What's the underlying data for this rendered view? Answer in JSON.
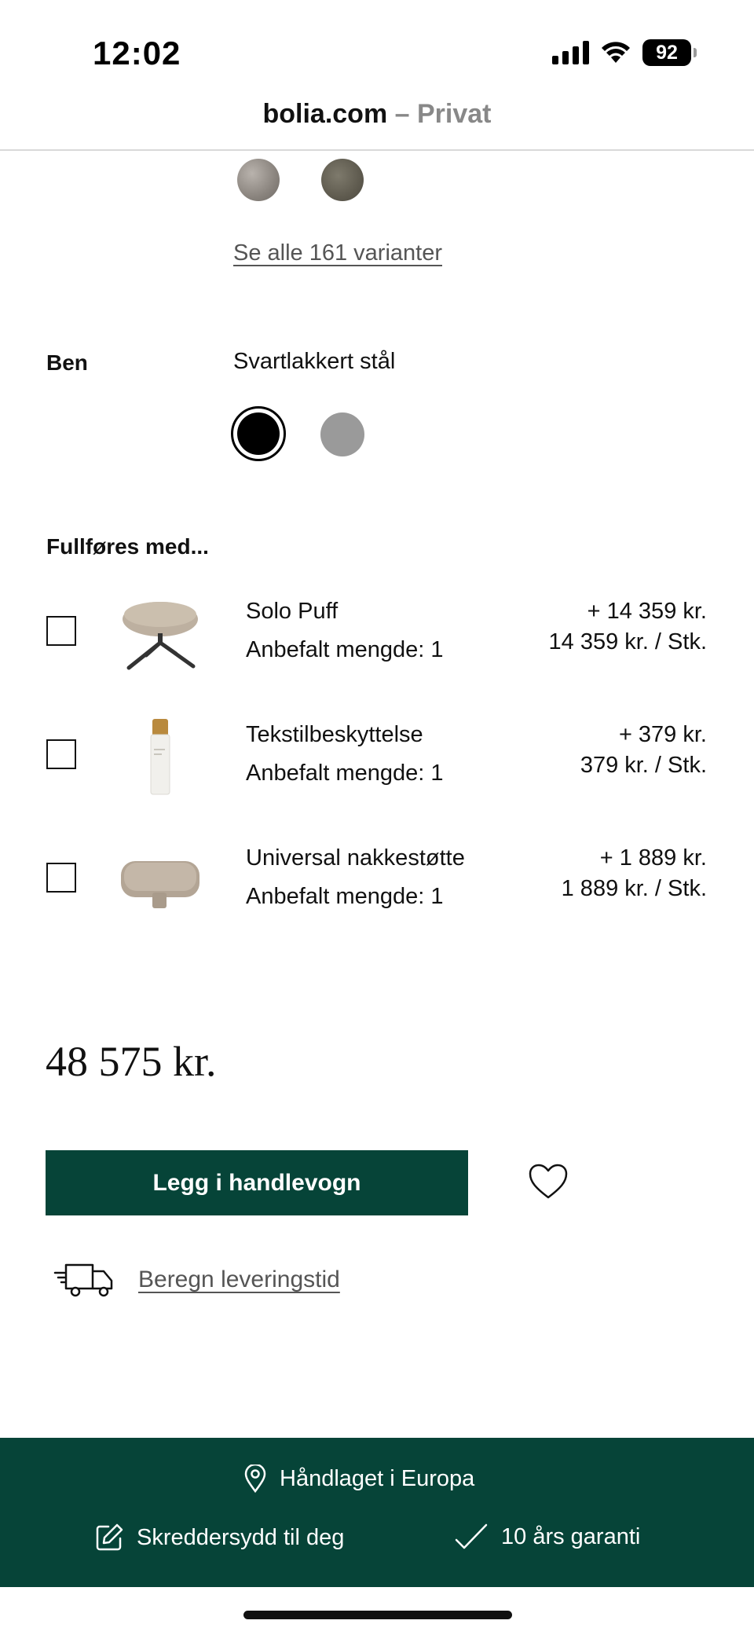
{
  "status_bar": {
    "time": "12:02",
    "battery": "92"
  },
  "url_bar": {
    "domain": "bolia.com",
    "suffix": " – Privat"
  },
  "fabric": {
    "see_all_label": "Se alle 161 varianter"
  },
  "legs": {
    "label": "Ben",
    "value": "Svartlakkert stål"
  },
  "addons": {
    "heading": "Fullføres med...",
    "items": [
      {
        "name": "Solo Puff",
        "qty": "Anbefalt mengde: 1",
        "price": "+ 14 359 kr.",
        "unit_price": "14 359 kr. / Stk.",
        "icon": "chair-icon"
      },
      {
        "name": "Tekstilbeskyttelse",
        "qty": "Anbefalt mengde: 1",
        "price": "+ 379 kr.",
        "unit_price": "379 kr. / Stk.",
        "icon": "spray-bottle-icon"
      },
      {
        "name": "Universal nakkestøtte",
        "qty": "Anbefalt mengde: 1",
        "price": "+ 1 889 kr.",
        "unit_price": "1 889 kr. / Stk.",
        "icon": "headrest-icon"
      }
    ]
  },
  "total_price": "48 575 kr.",
  "cta": {
    "add_to_cart": "Legg i handlevogn"
  },
  "delivery": {
    "label": "Beregn leveringstid"
  },
  "footer": {
    "europe": "Håndlaget i Europa",
    "custom": "Skreddersydd til deg",
    "guarantee": "10 års garanti"
  },
  "colors": {
    "brand_green": "#064438"
  }
}
